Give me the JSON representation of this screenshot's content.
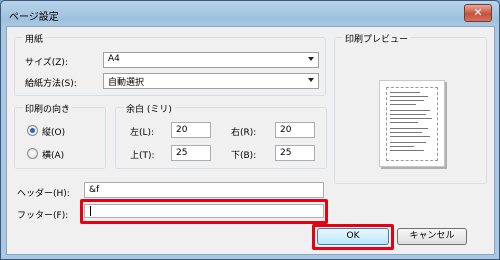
{
  "window": {
    "title": "ページ設定"
  },
  "paper_group": {
    "title": "用紙",
    "size_label": "サイズ(Z):",
    "size_value": "A4",
    "source_label": "給紙方法(S):",
    "source_value": "自動選択"
  },
  "preview": {
    "title": "印刷プレビュー"
  },
  "orientation": {
    "title": "印刷の向き",
    "portrait_label": "縦(O)",
    "landscape_label": "横(A)",
    "selected": "portrait"
  },
  "margins": {
    "title": "余白 (ミリ)",
    "left_label": "左(L):",
    "left_value": "20",
    "right_label": "右(R):",
    "right_value": "20",
    "top_label": "上(T):",
    "top_value": "25",
    "bottom_label": "下(B):",
    "bottom_value": "25"
  },
  "header": {
    "label": "ヘッダー(H):",
    "value": "&f"
  },
  "footer": {
    "label": "フッター(F):",
    "value": ""
  },
  "buttons": {
    "ok": "OK",
    "cancel": "キャンセル"
  },
  "highlight_color": "#e60012",
  "icons": {
    "close": "close-icon"
  }
}
